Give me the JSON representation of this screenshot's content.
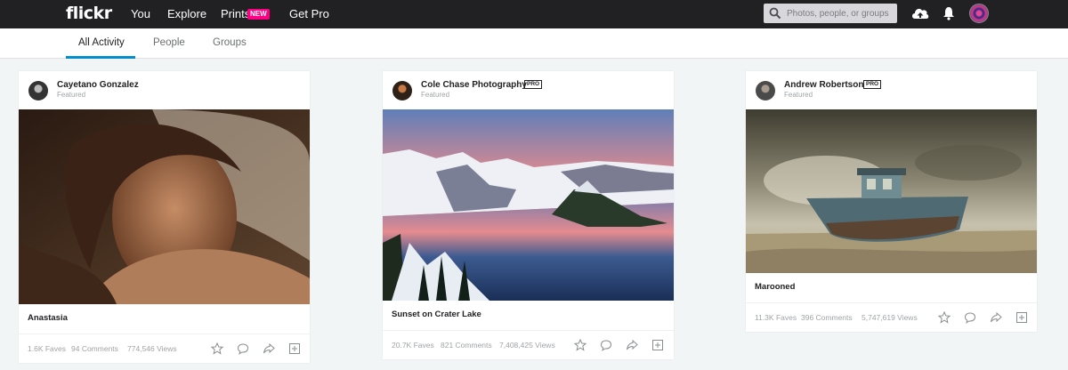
{
  "topnav": {
    "logo": "flickr",
    "links": {
      "you": "You",
      "explore": "Explore",
      "prints": "Prints",
      "prints_badge": "NEW",
      "get_pro": "Get Pro"
    },
    "search_placeholder": "Photos, people, or groups",
    "icons": [
      "search-icon",
      "upload-cloud-icon",
      "notifications-bell-icon",
      "user-avatar"
    ]
  },
  "subnav": {
    "tabs": [
      "All Activity",
      "People",
      "Groups"
    ],
    "active_tab": "All Activity"
  },
  "cards": [
    {
      "author": "Cayetano Gonzalez",
      "pro": false,
      "featured": "Featured",
      "title": "Anastasia",
      "faves": "1.6K Faves",
      "comments": "94 Comments",
      "views": "774,546 Views"
    },
    {
      "author": "Cole Chase Photography",
      "pro": true,
      "pro_label": "PRO",
      "featured": "Featured",
      "title": "Sunset on Crater Lake",
      "faves": "20.7K Faves",
      "comments": "821 Comments",
      "views": "7,408,425 Views"
    },
    {
      "author": "Andrew Robertson",
      "pro": true,
      "pro_label": "PRO",
      "featured": "Featured",
      "title": "Marooned",
      "faves": "11.3K Faves",
      "comments": "396 Comments",
      "views": "5,747,619 Views"
    }
  ],
  "card_actions": [
    "fave-star-icon",
    "comment-icon",
    "share-icon",
    "add-to-gallery-icon"
  ],
  "colors": {
    "topbar": "#212124",
    "accent": "#008ecf",
    "new_badge": "#ff0084"
  }
}
